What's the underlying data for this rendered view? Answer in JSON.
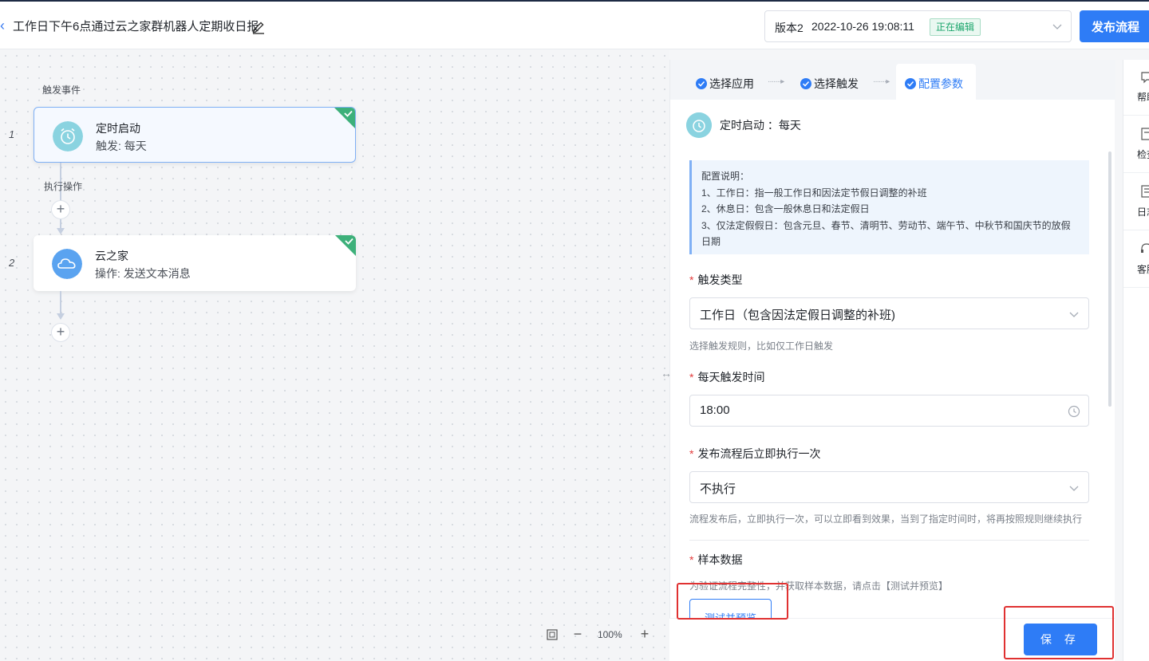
{
  "header": {
    "title": "工作日下午6点通过云之家群机器人定期收日报",
    "version_label": "版本2",
    "version_time": "2022-10-26 19:08:11",
    "editing_badge": "正在编辑",
    "publish_label": "发布流程"
  },
  "canvas": {
    "trigger_section": "触发事件",
    "action_section": "执行操作",
    "nodes": [
      {
        "index": "1",
        "title": "定时启动",
        "subtitle": "触发: 每天"
      },
      {
        "index": "2",
        "title": "云之家",
        "subtitle": "操作: 发送文本消息"
      }
    ],
    "zoom": "100%"
  },
  "panel": {
    "steps": [
      "选择应用",
      "选择触发",
      "配置参数"
    ],
    "trigger_header": "定时启动 ：每天",
    "info_lines": [
      "配置说明：",
      "1、工作日：指一般工作日和因法定节假日调整的补班",
      "2、休息日：包含一般休息日和法定假日",
      "3、仅法定假假日：包含元旦、春节、清明节、劳动节、端午节、中秋节和国庆节的放假",
      "日期"
    ],
    "trigger_type": {
      "label": "触发类型",
      "value": "工作日（包含因法定假日调整的补班)",
      "help": "选择触发规则，比如仅工作日触发"
    },
    "trigger_time": {
      "label": "每天触发时间",
      "value": "18:00"
    },
    "run_once": {
      "label": "发布流程后立即执行一次",
      "value": "不执行",
      "help": "流程发布后，立即执行一次，可以立即看到效果，当到了指定时间时，将再按照规则继续执行"
    },
    "sample": {
      "label": "样本数据",
      "help": "为验证流程完整性，并获取样本数据，请点击【测试并预览】",
      "button": "测试并预览"
    },
    "save_label": "保 存"
  },
  "rail": {
    "items": [
      "帮助",
      "检查",
      "日志",
      "客服"
    ]
  },
  "colors": {
    "primary": "#2e7cf6",
    "success": "#1aa56b",
    "highlight": "#e03131",
    "timer_icon": "#8ad3e0",
    "cloud_icon": "#5aa3f0"
  }
}
